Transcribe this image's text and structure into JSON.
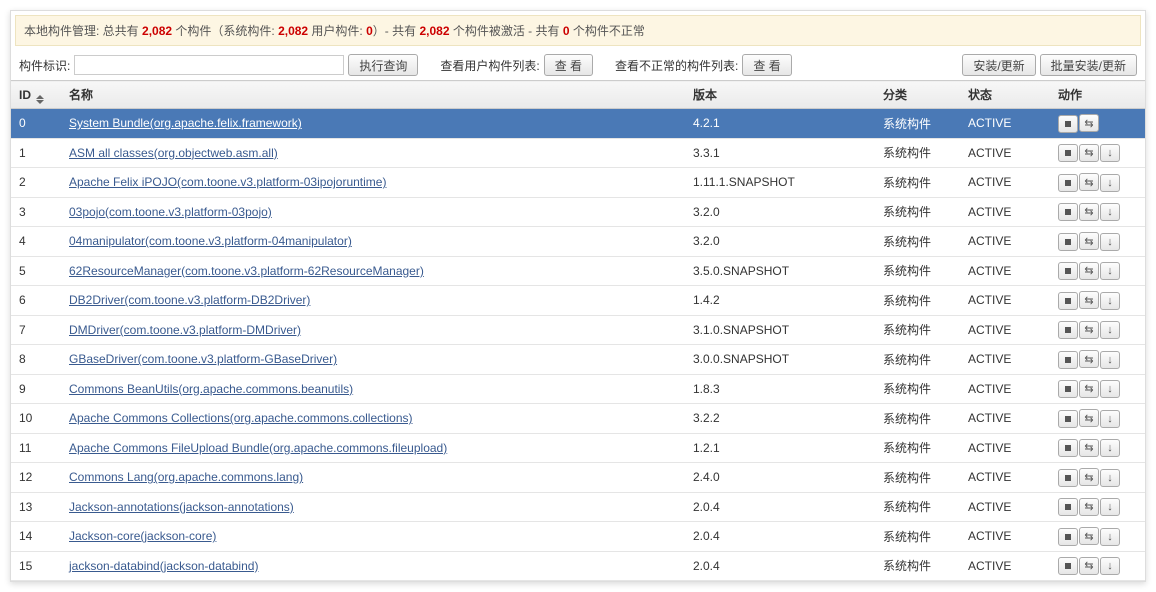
{
  "summary": {
    "prefix": "本地构件管理: 总共有 ",
    "total": "2,082",
    "mid1": " 个构件（系统构件: ",
    "sys": "2,082",
    "mid2": " 用户构件: ",
    "user": "0",
    "mid3": "）- 共有 ",
    "active": "2,082",
    "mid4": " 个构件被激活 - 共有 ",
    "bad": "0",
    "mid5": " 个构件不正常"
  },
  "toolbar": {
    "filter_label": "构件标识:",
    "filter_value": "",
    "run_query": "执行查询",
    "view_user_label": "查看用户构件列表:",
    "view_btn": "查  看",
    "view_bad_label": "查看不正常的构件列表:",
    "install": "安装/更新",
    "batch_install": "批量安装/更新"
  },
  "columns": {
    "id": "ID",
    "name": "名称",
    "version": "版本",
    "category": "分类",
    "status": "状态",
    "action": "动作"
  },
  "rows": [
    {
      "id": "0",
      "name": "System Bundle(org.apache.felix.framework)",
      "version": "4.2.1",
      "category": "系统构件",
      "status": "ACTIVE",
      "selected": true,
      "actions": [
        "stop",
        "refresh"
      ]
    },
    {
      "id": "1",
      "name": "ASM all classes(org.objectweb.asm.all)",
      "version": "3.3.1",
      "category": "系统构件",
      "status": "ACTIVE",
      "actions": [
        "stop",
        "refresh",
        "down"
      ]
    },
    {
      "id": "2",
      "name": "Apache Felix iPOJO(com.toone.v3.platform-03ipojoruntime)",
      "version": "1.11.1.SNAPSHOT",
      "category": "系统构件",
      "status": "ACTIVE",
      "actions": [
        "stop",
        "refresh",
        "down"
      ]
    },
    {
      "id": "3",
      "name": "03pojo(com.toone.v3.platform-03pojo)",
      "version": "3.2.0",
      "category": "系统构件",
      "status": "ACTIVE",
      "actions": [
        "stop",
        "refresh",
        "down"
      ]
    },
    {
      "id": "4",
      "name": "04manipulator(com.toone.v3.platform-04manipulator)",
      "version": "3.2.0",
      "category": "系统构件",
      "status": "ACTIVE",
      "actions": [
        "stop",
        "refresh",
        "down"
      ]
    },
    {
      "id": "5",
      "name": "62ResourceManager(com.toone.v3.platform-62ResourceManager)",
      "version": "3.5.0.SNAPSHOT",
      "category": "系统构件",
      "status": "ACTIVE",
      "actions": [
        "stop",
        "refresh",
        "down"
      ]
    },
    {
      "id": "6",
      "name": "DB2Driver(com.toone.v3.platform-DB2Driver)",
      "version": "1.4.2",
      "category": "系统构件",
      "status": "ACTIVE",
      "actions": [
        "stop",
        "refresh",
        "down"
      ]
    },
    {
      "id": "7",
      "name": "DMDriver(com.toone.v3.platform-DMDriver)",
      "version": "3.1.0.SNAPSHOT",
      "category": "系统构件",
      "status": "ACTIVE",
      "actions": [
        "stop",
        "refresh",
        "down"
      ]
    },
    {
      "id": "8",
      "name": "GBaseDriver(com.toone.v3.platform-GBaseDriver)",
      "version": "3.0.0.SNAPSHOT",
      "category": "系统构件",
      "status": "ACTIVE",
      "actions": [
        "stop",
        "refresh",
        "down"
      ]
    },
    {
      "id": "9",
      "name": "Commons BeanUtils(org.apache.commons.beanutils)",
      "version": "1.8.3",
      "category": "系统构件",
      "status": "ACTIVE",
      "actions": [
        "stop",
        "refresh",
        "down"
      ]
    },
    {
      "id": "10",
      "name": "Apache Commons Collections(org.apache.commons.collections)",
      "version": "3.2.2",
      "category": "系统构件",
      "status": "ACTIVE",
      "actions": [
        "stop",
        "refresh",
        "down"
      ]
    },
    {
      "id": "11",
      "name": "Apache Commons FileUpload Bundle(org.apache.commons.fileupload)",
      "version": "1.2.1",
      "category": "系统构件",
      "status": "ACTIVE",
      "actions": [
        "stop",
        "refresh",
        "down"
      ]
    },
    {
      "id": "12",
      "name": "Commons Lang(org.apache.commons.lang)",
      "version": "2.4.0",
      "category": "系统构件",
      "status": "ACTIVE",
      "actions": [
        "stop",
        "refresh",
        "down"
      ]
    },
    {
      "id": "13",
      "name": "Jackson-annotations(jackson-annotations)",
      "version": "2.0.4",
      "category": "系统构件",
      "status": "ACTIVE",
      "actions": [
        "stop",
        "refresh",
        "down"
      ]
    },
    {
      "id": "14",
      "name": "Jackson-core(jackson-core)",
      "version": "2.0.4",
      "category": "系统构件",
      "status": "ACTIVE",
      "actions": [
        "stop",
        "refresh",
        "down"
      ]
    },
    {
      "id": "15",
      "name": "jackson-databind(jackson-databind)",
      "version": "2.0.4",
      "category": "系统构件",
      "status": "ACTIVE",
      "actions": [
        "stop",
        "refresh",
        "down"
      ]
    }
  ]
}
